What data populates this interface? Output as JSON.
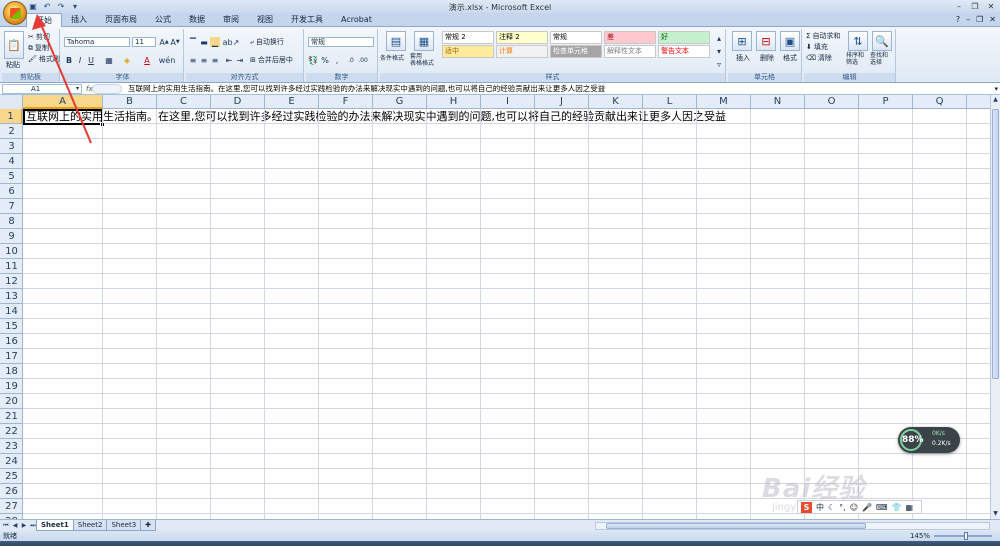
{
  "window": {
    "title": "演示.xlsx - Microsoft Excel"
  },
  "qat": [
    "save-icon",
    "undo-icon",
    "redo-icon",
    "dropdown-icon"
  ],
  "tabs": [
    "开始",
    "插入",
    "页面布局",
    "公式",
    "数据",
    "审阅",
    "视图",
    "开发工具",
    "Acrobat"
  ],
  "clipboard": {
    "paste": "粘贴",
    "cut": "剪切",
    "copy": "复制",
    "format_painter": "格式刷",
    "label": "剪贴板"
  },
  "font": {
    "name": "Tahoma",
    "size": "11",
    "label": "字体"
  },
  "alignment": {
    "wrap": "自动换行",
    "merge": "合并后居中",
    "label": "对齐方式"
  },
  "number": {
    "format": "常规",
    "label": "数字"
  },
  "styles": {
    "cond": "条件格式",
    "table": "套用\n表格格式",
    "label": "样式",
    "cells": [
      {
        "text": "常规 2",
        "bg": "#ffffff",
        "color": "#000000"
      },
      {
        "text": "注释 2",
        "bg": "#ffffcc",
        "color": "#000000"
      },
      {
        "text": "常规",
        "bg": "#ffffff",
        "color": "#000000"
      },
      {
        "text": "差",
        "bg": "#ffc7ce",
        "color": "#9c0006"
      },
      {
        "text": "好",
        "bg": "#c6efce",
        "color": "#006100"
      },
      {
        "text": "适中",
        "bg": "#ffeb9c",
        "color": "#9c6500"
      },
      {
        "text": "计算",
        "bg": "#f2f2f2",
        "color": "#fa7d00"
      },
      {
        "text": "检查单元格",
        "bg": "#a5a5a5",
        "color": "#ffffff"
      },
      {
        "text": "解释性文本",
        "bg": "#ffffff",
        "color": "#7f7f7f"
      },
      {
        "text": "警告文本",
        "bg": "#ffffff",
        "color": "#ff0000"
      }
    ]
  },
  "cells_group": {
    "insert": "插入",
    "delete": "删除",
    "format": "格式",
    "label": "单元格"
  },
  "editing": {
    "autosum": "自动求和",
    "fill": "填充",
    "clear": "清除",
    "sort": "排序和\n筛选",
    "find": "查找和\n选择",
    "label": "编辑"
  },
  "formula_bar": {
    "name_box": "A1",
    "content": "互联网上的实用生活指南。在这里,您可以找到许多经过实践检验的办法来解决现实中遇到的问题,也可以将自己的经验贡献出来让更多人因之受益"
  },
  "columns": [
    "A",
    "B",
    "C",
    "D",
    "E",
    "F",
    "G",
    "H",
    "I",
    "J",
    "K",
    "L",
    "M",
    "N",
    "O",
    "P",
    "Q"
  ],
  "rows": [
    "1",
    "2",
    "3",
    "4",
    "5",
    "6",
    "7",
    "8",
    "9",
    "10",
    "11",
    "12",
    "13",
    "14",
    "15",
    "16",
    "17",
    "18",
    "19",
    "20",
    "21",
    "22",
    "23",
    "24",
    "25",
    "26",
    "27",
    "28",
    "29"
  ],
  "cell_a1": "互联网上的实用生活指南。在这里,您可以找到许多经过实践检验的办法来解决现实中遇到的问题,也可以将自己的经验贡献出来让更多人因之受益",
  "sheets": [
    "Sheet1",
    "Sheet2",
    "Sheet3"
  ],
  "status": {
    "mode": "就绪",
    "zoom": "145%"
  },
  "net_widget": {
    "percent": "88%",
    "up": "0K/s",
    "down": "0.2K/s"
  },
  "watermark": {
    "logo": "Bai经验",
    "url": "jingyan.baidu.com"
  },
  "ime": {
    "logo": "S",
    "lang": "中"
  },
  "annotation": {
    "color": "#e53935"
  }
}
